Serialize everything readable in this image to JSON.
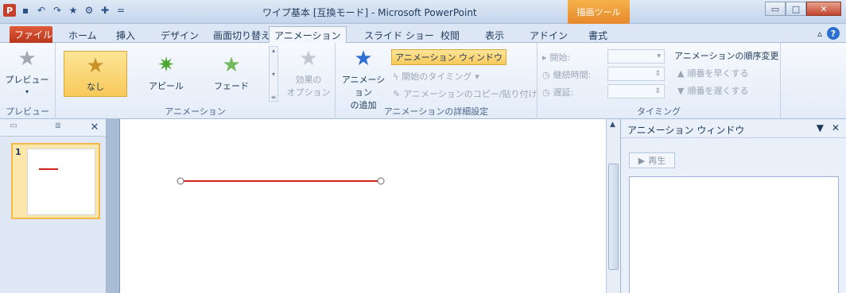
{
  "window": {
    "title": "ワイプ基本 [互換モード] - Microsoft PowerPoint",
    "context_tools": "描画ツール",
    "app_logo_letter": "P",
    "controls": {
      "minimize": "▭",
      "maximize": "□",
      "close": "✕"
    }
  },
  "quick_access": {
    "icons": [
      "save-icon",
      "undo-icon",
      "redo-icon",
      "star-icon",
      "animation-window-icon",
      "add-animation-icon",
      "customize-icon"
    ],
    "glyphs": {
      "save": "▪",
      "undo": "↶",
      "redo": "↷",
      "star": "★",
      "anim": "⚙",
      "add": "✚",
      "customize": "="
    }
  },
  "tabs": {
    "file": "ファイル",
    "home": "ホーム",
    "insert": "挿入",
    "design": "デザイン",
    "transitions": "画面切り替え",
    "animations": "アニメーション",
    "slideshow": "スライド ショー",
    "review": "校閲",
    "view": "表示",
    "addins": "アドイン",
    "format": "書式"
  },
  "ribbon": {
    "preview": {
      "button": "プレビュー",
      "group": "プレビュー"
    },
    "animation": {
      "group": "アニメーション",
      "items": [
        "なし",
        "アピール",
        "フェード"
      ],
      "effect_options": "効果の\nオプション"
    },
    "advanced": {
      "group": "アニメーションの詳細設定",
      "add_animation": "アニメーション\nの追加",
      "animation_pane": "アニメーション ウィンドウ",
      "trigger": "開始のタイミング",
      "painter": "アニメーションのコピー/貼り付け"
    },
    "timing": {
      "group": "タイミング",
      "start": "開始:",
      "duration": "継続時間:",
      "delay": "遅延:",
      "reorder": "アニメーションの順序変更",
      "move_earlier": "順番を早くする",
      "move_later": "順番を遅くする"
    }
  },
  "thumbnails": {
    "slide_number": "1"
  },
  "animation_pane": {
    "title": "アニメーション ウィンドウ",
    "play": "再生"
  },
  "colors": {
    "line": "#d61f1f",
    "file_tab": "#c9401f",
    "context_tools": "#e8902d"
  }
}
